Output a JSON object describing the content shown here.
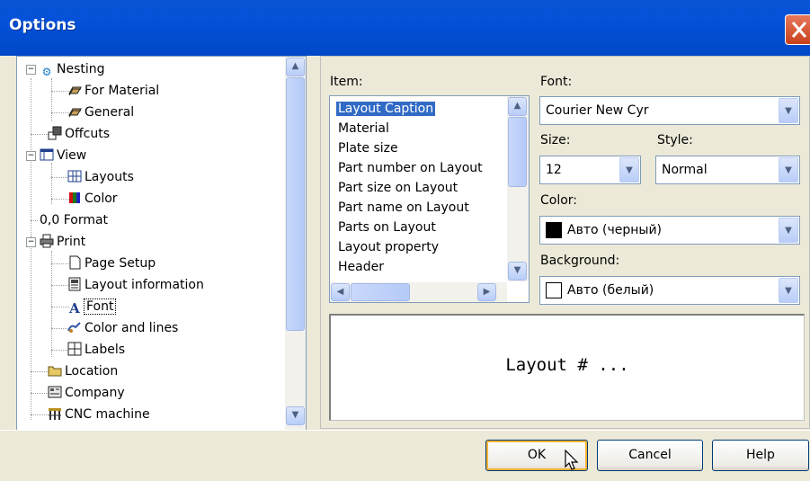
{
  "window": {
    "title": "Options"
  },
  "tree": {
    "items": [
      {
        "label": "Nesting",
        "icon": "gear-icon"
      },
      {
        "label": "For Material",
        "icon": "sheet-stack-icon"
      },
      {
        "label": "General",
        "icon": "sheet-stack-icon"
      },
      {
        "label": "Offcuts",
        "icon": "offcuts-icon"
      },
      {
        "label": "View",
        "icon": "view-icon"
      },
      {
        "label": "Layouts",
        "icon": "layouts-icon"
      },
      {
        "label": "Color",
        "icon": "color-bars-icon"
      },
      {
        "label": "0,0 Format",
        "icon": ""
      },
      {
        "label": "Print",
        "icon": "printer-icon"
      },
      {
        "label": "Page Setup",
        "icon": "page-icon"
      },
      {
        "label": "Layout information",
        "icon": "layout-info-icon"
      },
      {
        "label": "Font",
        "icon": "font-icon"
      },
      {
        "label": "Color and lines",
        "icon": "brush-icon"
      },
      {
        "label": "Labels",
        "icon": "labels-icon"
      },
      {
        "label": "Location",
        "icon": "folder-icon"
      },
      {
        "label": "Company",
        "icon": "company-icon"
      },
      {
        "label": "CNC machine",
        "icon": "cnc-icon"
      }
    ],
    "selected": "Font"
  },
  "item_label": "Item:",
  "items": [
    "Layout Caption",
    "Material",
    "Plate size",
    "Part number on Layout",
    "Part size on Layout",
    "Part name on Layout",
    "Parts on Layout",
    "Layout property",
    "Header"
  ],
  "selected_item": "Layout Caption",
  "font": {
    "label": "Font:",
    "value": "Courier New Cyr"
  },
  "size": {
    "label": "Size:",
    "value": "12"
  },
  "style": {
    "label": "Style:",
    "value": "Normal"
  },
  "color": {
    "label": "Color:",
    "value": "Авто (черный)",
    "swatch": "#000000"
  },
  "background": {
    "label": "Background:",
    "value": "Авто (белый)",
    "swatch": "#FFFFFF"
  },
  "preview_text": "Layout # ...",
  "buttons": {
    "ok": "OK",
    "cancel": "Cancel",
    "help": "Help"
  }
}
